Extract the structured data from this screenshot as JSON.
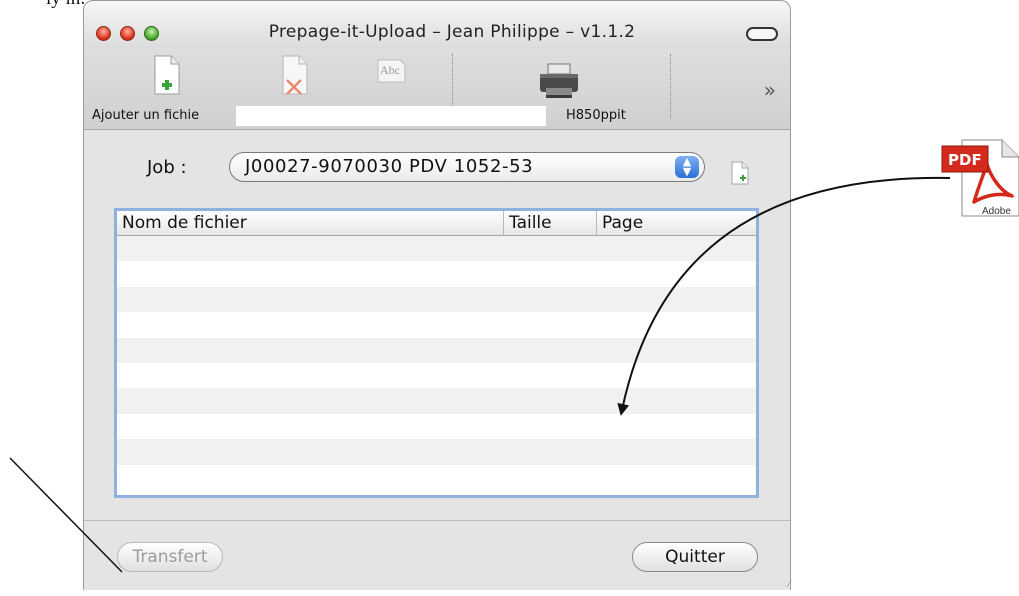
{
  "page_text": "ly in: apply",
  "window": {
    "title": "Prepage-it-Upload – Jean Philippe – v1.1.2"
  },
  "toolbar": {
    "add_file_label": "Ajouter un fichie",
    "printer_label": "H850ppit",
    "overflow_glyph": "»",
    "icons": [
      "add-file-icon",
      "delete-file-icon",
      "rename-file-icon",
      "printer-icon",
      "overflow-chevron-icon"
    ]
  },
  "job": {
    "label": "Job :",
    "selected": "J00027-9070030 PDV 1052-53"
  },
  "table": {
    "columns": [
      "Nom de fichier",
      "Taille",
      "Page"
    ],
    "rows": []
  },
  "buttons": {
    "transfer": "Transfert",
    "quit": "Quitter"
  },
  "pdf_icon": {
    "badge": "PDF",
    "caption": "Adobe"
  },
  "colors": {
    "close": "#e03a22",
    "zoom": "#4fae2d",
    "focus_ring": "#8fb1dd",
    "select_arrows": "#2a6fd6"
  }
}
